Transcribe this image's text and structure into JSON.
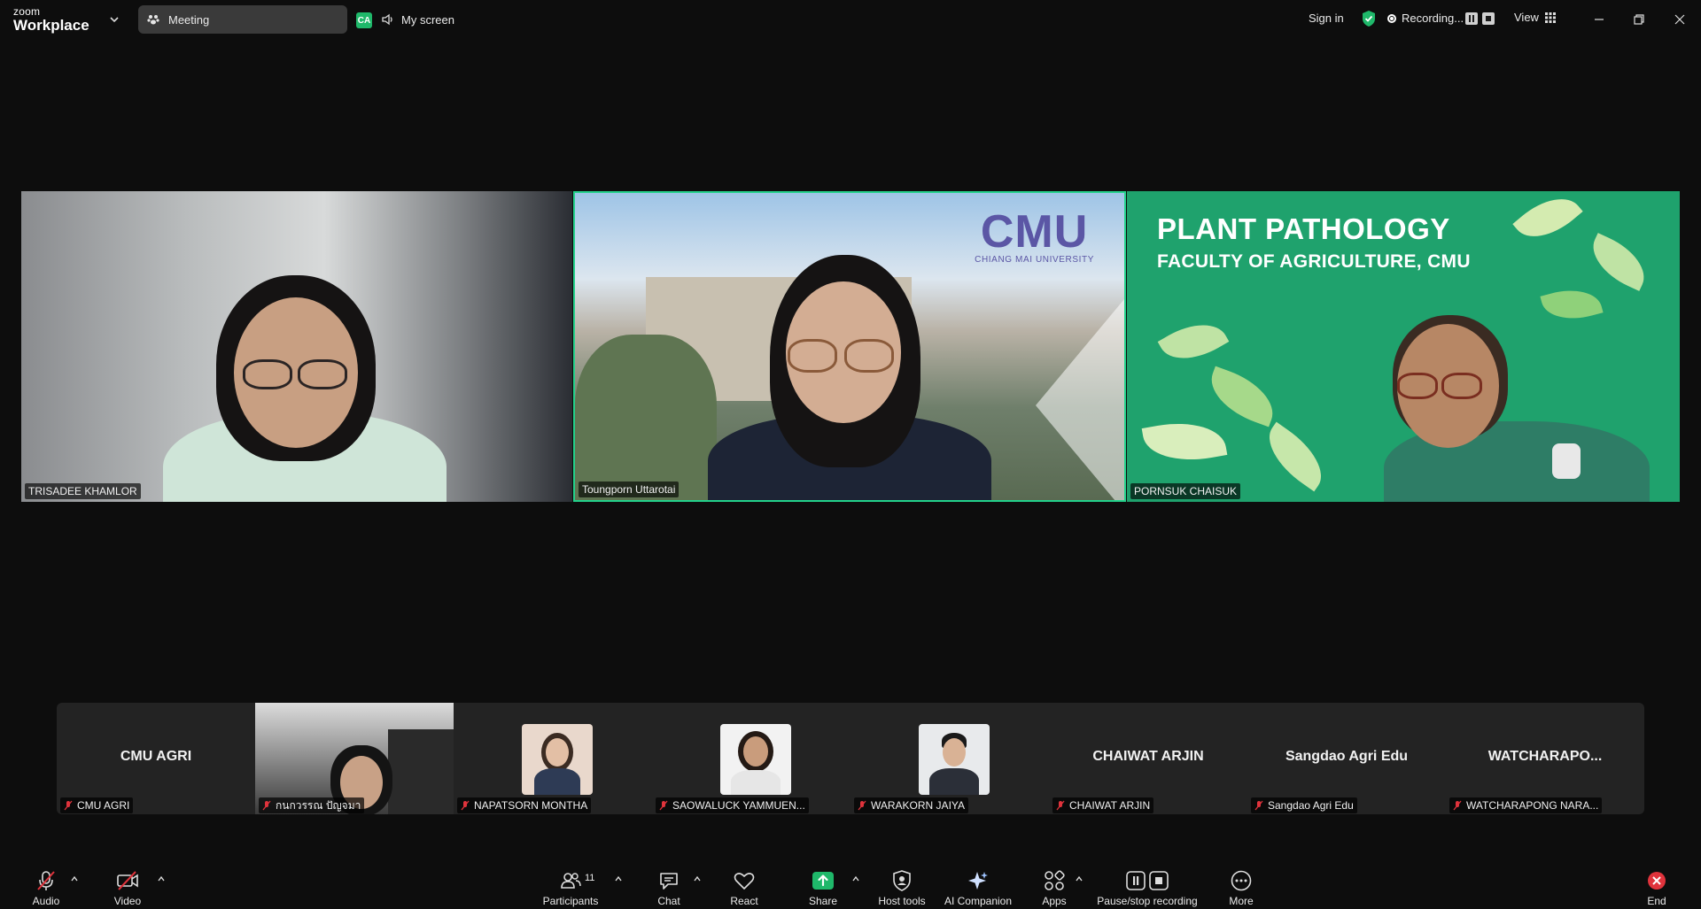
{
  "topbar": {
    "brand_small": "zoom",
    "brand_large": "Workplace",
    "meeting_label": "Meeting",
    "share_badge": "CA",
    "my_screen": "My screen",
    "sign_in": "Sign in",
    "recording": "Recording...",
    "view": "View"
  },
  "gallery": [
    {
      "name": "TRISADEE KHAMLOR"
    },
    {
      "name": "Toungporn Uttarotai",
      "active_speaker": true,
      "logo_big": "CMU",
      "logo_small": "CHIANG MAI UNIVERSITY"
    },
    {
      "name": "PORNSUK CHAISUK",
      "banner_title": "PLANT PATHOLOGY",
      "banner_subtitle": "FACULTY OF AGRICULTURE, CMU"
    }
  ],
  "strip": [
    {
      "title": "CMU AGRI",
      "label": "CMU AGRI"
    },
    {
      "title": "",
      "label": "กนกวรรณ ปัญจมา"
    },
    {
      "title": "",
      "label": "NAPATSORN MONTHA"
    },
    {
      "title": "",
      "label": "SAOWALUCK YAMMUEN..."
    },
    {
      "title": "",
      "label": "WARAKORN JAIYA"
    },
    {
      "title": "CHAIWAT ARJIN",
      "label": "CHAIWAT ARJIN"
    },
    {
      "title": "Sangdao Agri Edu",
      "label": "Sangdao Agri Edu"
    },
    {
      "title": "WATCHARAPO...",
      "label": "WATCHARAPONG NARA..."
    }
  ],
  "toolbar": {
    "audio": "Audio",
    "video": "Video",
    "participants": "Participants",
    "participants_count": "11",
    "chat": "Chat",
    "react": "React",
    "share": "Share",
    "host_tools": "Host tools",
    "ai_companion": "AI Companion",
    "apps": "Apps",
    "pause_stop": "Pause/stop recording",
    "more": "More",
    "end": "End"
  },
  "colors": {
    "active_border": "#23d18b",
    "share_green": "#1fb86a",
    "mute_red": "#e0333c",
    "plant_bg": "#1fa26d",
    "cmu_purple": "#5b56a5"
  }
}
